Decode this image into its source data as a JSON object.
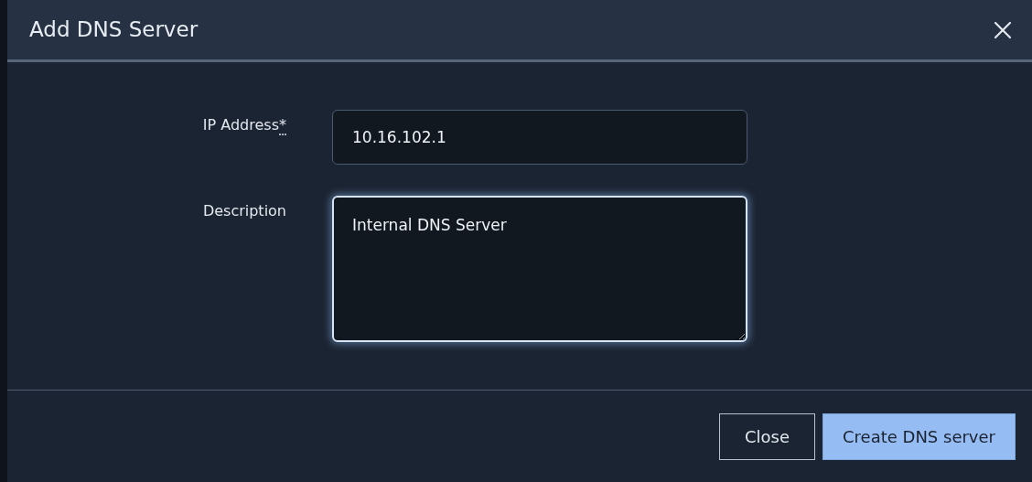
{
  "dialog": {
    "title": "Add DNS Server"
  },
  "fields": [
    {
      "kind": "input",
      "label": "IP Address",
      "required_mark": "*",
      "value": "10.16.102.1",
      "focused": false
    },
    {
      "kind": "textarea",
      "label": "Description",
      "value": "Internal DNS Server",
      "focused": true
    }
  ],
  "buttons": [
    {
      "kind": "secondary",
      "label": "Close"
    },
    {
      "kind": "primary",
      "label": "Create DNS server"
    }
  ]
}
